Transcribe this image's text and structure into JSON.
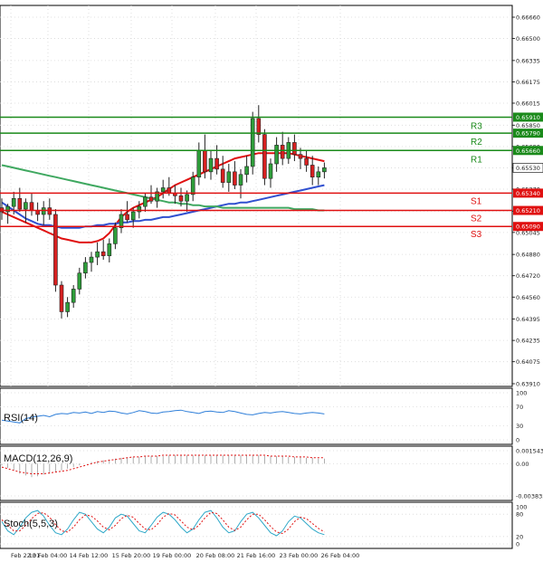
{
  "chart_data": {
    "type": "candlestick",
    "price_axis": {
      "ticks": [
        "0.66660",
        "0.66500",
        "0.66335",
        "0.66175",
        "0.66015",
        "0.65850",
        "0.65690",
        "0.65530",
        "0.65370",
        "0.65205",
        "0.65045",
        "0.64880",
        "0.64720",
        "0.64560",
        "0.64395",
        "0.64235",
        "0.64075",
        "0.63910"
      ],
      "ylim": [
        0.6391,
        0.6666
      ]
    },
    "levels": [
      {
        "label": "R3",
        "value": "0.65910",
        "color": "#1a8a1a"
      },
      {
        "label": "R2",
        "value": "0.65790",
        "color": "#1a8a1a"
      },
      {
        "label": "R1",
        "value": "0.65660",
        "color": "#1a8a1a"
      },
      {
        "label": "S1",
        "value": "0.65340",
        "color": "#e01010"
      },
      {
        "label": "S2",
        "value": "0.65210",
        "color": "#e01010"
      },
      {
        "label": "S3",
        "value": "0.65090",
        "color": "#e01010"
      }
    ],
    "current_price": "0.65530",
    "x_ticks": [
      "Feb 22:01",
      "13 Feb 04:00",
      "14 Feb 12:00",
      "15 Feb 20:00",
      "19 Feb 00:00",
      "20 Feb 08:00",
      "21 Feb 16:00",
      "23 Feb 00:00",
      "26 Feb 04:00"
    ],
    "candles": [
      {
        "o": 0.6523,
        "h": 0.653,
        "l": 0.6514,
        "c": 0.652
      },
      {
        "o": 0.652,
        "h": 0.6526,
        "l": 0.6511,
        "c": 0.6524
      },
      {
        "o": 0.6524,
        "h": 0.6535,
        "l": 0.6518,
        "c": 0.653
      },
      {
        "o": 0.653,
        "h": 0.6538,
        "l": 0.652,
        "c": 0.6522
      },
      {
        "o": 0.6522,
        "h": 0.653,
        "l": 0.6512,
        "c": 0.6527
      },
      {
        "o": 0.6527,
        "h": 0.6534,
        "l": 0.6517,
        "c": 0.6521
      },
      {
        "o": 0.6521,
        "h": 0.6527,
        "l": 0.6513,
        "c": 0.6518
      },
      {
        "o": 0.6518,
        "h": 0.6528,
        "l": 0.651,
        "c": 0.6523
      },
      {
        "o": 0.6523,
        "h": 0.653,
        "l": 0.6514,
        "c": 0.6518
      },
      {
        "o": 0.6518,
        "h": 0.6522,
        "l": 0.646,
        "c": 0.6465
      },
      {
        "o": 0.6465,
        "h": 0.6468,
        "l": 0.644,
        "c": 0.6445
      },
      {
        "o": 0.6445,
        "h": 0.6456,
        "l": 0.6441,
        "c": 0.6452
      },
      {
        "o": 0.6452,
        "h": 0.6465,
        "l": 0.6448,
        "c": 0.6462
      },
      {
        "o": 0.6462,
        "h": 0.6478,
        "l": 0.6458,
        "c": 0.6474
      },
      {
        "o": 0.6474,
        "h": 0.6486,
        "l": 0.647,
        "c": 0.6482
      },
      {
        "o": 0.6482,
        "h": 0.649,
        "l": 0.6475,
        "c": 0.6486
      },
      {
        "o": 0.6486,
        "h": 0.6497,
        "l": 0.648,
        "c": 0.649
      },
      {
        "o": 0.649,
        "h": 0.6499,
        "l": 0.6484,
        "c": 0.6487
      },
      {
        "o": 0.6487,
        "h": 0.65,
        "l": 0.6482,
        "c": 0.6496
      },
      {
        "o": 0.6496,
        "h": 0.6512,
        "l": 0.6492,
        "c": 0.6508
      },
      {
        "o": 0.6508,
        "h": 0.6522,
        "l": 0.6504,
        "c": 0.6518
      },
      {
        "o": 0.6518,
        "h": 0.6528,
        "l": 0.6512,
        "c": 0.6514
      },
      {
        "o": 0.6514,
        "h": 0.6523,
        "l": 0.6508,
        "c": 0.652
      },
      {
        "o": 0.652,
        "h": 0.6528,
        "l": 0.6515,
        "c": 0.6524
      },
      {
        "o": 0.6524,
        "h": 0.6534,
        "l": 0.652,
        "c": 0.6531
      },
      {
        "o": 0.6531,
        "h": 0.654,
        "l": 0.6526,
        "c": 0.6528
      },
      {
        "o": 0.6528,
        "h": 0.6538,
        "l": 0.6523,
        "c": 0.6535
      },
      {
        "o": 0.6535,
        "h": 0.6544,
        "l": 0.653,
        "c": 0.6538
      },
      {
        "o": 0.6538,
        "h": 0.6546,
        "l": 0.6532,
        "c": 0.6534
      },
      {
        "o": 0.6534,
        "h": 0.654,
        "l": 0.6526,
        "c": 0.6532
      },
      {
        "o": 0.6532,
        "h": 0.6538,
        "l": 0.6524,
        "c": 0.6528
      },
      {
        "o": 0.6528,
        "h": 0.6536,
        "l": 0.652,
        "c": 0.6533
      },
      {
        "o": 0.6533,
        "h": 0.655,
        "l": 0.6528,
        "c": 0.6546
      },
      {
        "o": 0.6546,
        "h": 0.6572,
        "l": 0.654,
        "c": 0.6566
      },
      {
        "o": 0.6566,
        "h": 0.6578,
        "l": 0.6545,
        "c": 0.655
      },
      {
        "o": 0.655,
        "h": 0.6566,
        "l": 0.6544,
        "c": 0.656
      },
      {
        "o": 0.656,
        "h": 0.657,
        "l": 0.6548,
        "c": 0.6552
      },
      {
        "o": 0.6552,
        "h": 0.6562,
        "l": 0.6538,
        "c": 0.6542
      },
      {
        "o": 0.6542,
        "h": 0.6556,
        "l": 0.6535,
        "c": 0.655
      },
      {
        "o": 0.655,
        "h": 0.6558,
        "l": 0.6537,
        "c": 0.654
      },
      {
        "o": 0.654,
        "h": 0.6552,
        "l": 0.653,
        "c": 0.6548
      },
      {
        "o": 0.6548,
        "h": 0.6562,
        "l": 0.6542,
        "c": 0.6554
      },
      {
        "o": 0.6554,
        "h": 0.6595,
        "l": 0.6548,
        "c": 0.659
      },
      {
        "o": 0.659,
        "h": 0.66,
        "l": 0.6572,
        "c": 0.6578
      },
      {
        "o": 0.6578,
        "h": 0.6582,
        "l": 0.654,
        "c": 0.6545
      },
      {
        "o": 0.6545,
        "h": 0.656,
        "l": 0.6538,
        "c": 0.6556
      },
      {
        "o": 0.6556,
        "h": 0.6576,
        "l": 0.655,
        "c": 0.657
      },
      {
        "o": 0.657,
        "h": 0.658,
        "l": 0.6555,
        "c": 0.656
      },
      {
        "o": 0.656,
        "h": 0.6576,
        "l": 0.6556,
        "c": 0.6572
      },
      {
        "o": 0.6572,
        "h": 0.6578,
        "l": 0.6558,
        "c": 0.6563
      },
      {
        "o": 0.6563,
        "h": 0.6568,
        "l": 0.6552,
        "c": 0.656
      },
      {
        "o": 0.656,
        "h": 0.6566,
        "l": 0.655,
        "c": 0.6555
      },
      {
        "o": 0.6555,
        "h": 0.6562,
        "l": 0.654,
        "c": 0.6546
      },
      {
        "o": 0.6546,
        "h": 0.6554,
        "l": 0.654,
        "c": 0.655
      },
      {
        "o": 0.655,
        "h": 0.6557,
        "l": 0.6545,
        "c": 0.6553
      }
    ],
    "moving_averages": [
      {
        "color": "#e01010",
        "values": [
          0.652,
          0.6518,
          0.6516,
          0.6514,
          0.6512,
          0.651,
          0.6508,
          0.6506,
          0.6504,
          0.6502,
          0.65,
          0.6499,
          0.6498,
          0.6497,
          0.6497,
          0.6497,
          0.6498,
          0.65,
          0.6504,
          0.651,
          0.6516,
          0.652,
          0.6523,
          0.6525,
          0.6527,
          0.6529,
          0.6531,
          0.6534,
          0.6537,
          0.654,
          0.6542,
          0.6544,
          0.6546,
          0.6548,
          0.655,
          0.6552,
          0.6554,
          0.6556,
          0.6558,
          0.656,
          0.6561,
          0.6562,
          0.6563,
          0.6564,
          0.6564,
          0.6564,
          0.6564,
          0.6564,
          0.6564,
          0.6563,
          0.6562,
          0.6561,
          0.656,
          0.6559,
          0.6558
        ]
      },
      {
        "color": "#3050d0",
        "values": [
          0.6527,
          0.6524,
          0.6521,
          0.6518,
          0.6515,
          0.6513,
          0.6511,
          0.651,
          0.651,
          0.6509,
          0.6508,
          0.6508,
          0.6508,
          0.6508,
          0.6509,
          0.6509,
          0.651,
          0.651,
          0.6511,
          0.6511,
          0.6512,
          0.6512,
          0.6513,
          0.6513,
          0.6514,
          0.6514,
          0.6515,
          0.6516,
          0.6516,
          0.6517,
          0.6518,
          0.6519,
          0.652,
          0.6521,
          0.6522,
          0.6523,
          0.6524,
          0.6525,
          0.6526,
          0.6526,
          0.6527,
          0.6527,
          0.6528,
          0.6529,
          0.653,
          0.6531,
          0.6532,
          0.6533,
          0.6534,
          0.6535,
          0.6536,
          0.6537,
          0.6538,
          0.6539,
          0.654
        ]
      },
      {
        "color": "#3fa860",
        "values": [
          0.6555,
          0.6554,
          0.6553,
          0.6552,
          0.6551,
          0.655,
          0.6549,
          0.6548,
          0.6547,
          0.6546,
          0.6545,
          0.6544,
          0.6543,
          0.6542,
          0.6541,
          0.654,
          0.6539,
          0.6538,
          0.6537,
          0.6536,
          0.6535,
          0.6534,
          0.6533,
          0.6532,
          0.6531,
          0.653,
          0.6529,
          0.6528,
          0.6527,
          0.6527,
          0.6526,
          0.6526,
          0.6525,
          0.6525,
          0.6524,
          0.6524,
          0.6524,
          0.6523,
          0.6523,
          0.6523,
          0.6523,
          0.6523,
          0.6523,
          0.6523,
          0.6523,
          0.6523,
          0.6523,
          0.6523,
          0.6523,
          0.6522,
          0.6522,
          0.6522,
          0.6522,
          0.6521,
          0.6521
        ]
      }
    ],
    "panels": [
      {
        "title": "RSI(14)",
        "ticks": [
          "100",
          "70",
          "30",
          "0"
        ],
        "ylim": [
          0,
          100
        ],
        "series": [
          {
            "color": "#2f7fd9",
            "style": "solid",
            "values": [
              42,
              40,
              38,
              36,
              45,
              48,
              50,
              52,
              49,
              54,
              56,
              55,
              58,
              57,
              59,
              56,
              60,
              58,
              61,
              60,
              57,
              55,
              58,
              62,
              60,
              57,
              56,
              59,
              60,
              62,
              63,
              60,
              58,
              56,
              60,
              61,
              59,
              58,
              62,
              60,
              57,
              54,
              53,
              56,
              58,
              57,
              59,
              60,
              58,
              56,
              55,
              57,
              58,
              57,
              55
            ]
          }
        ]
      },
      {
        "title": "MACD(12,26,9)",
        "ticks": [
          "0.001543",
          "0.00",
          "-0.003835"
        ],
        "ylim": [
          -0.003835,
          0.001543
        ],
        "series": [
          {
            "color": "#e01010",
            "style": "dashed",
            "values": [
              -0.0004,
              -0.0006,
              -0.0008,
              -0.001,
              -0.0011,
              -0.0012,
              -0.0012,
              -0.0012,
              -0.0011,
              -0.001,
              -0.0009,
              -0.0008,
              -0.0006,
              -0.0004,
              -0.0002,
              0.0,
              0.0002,
              0.0003,
              0.0004,
              0.0005,
              0.0006,
              0.0007,
              0.0008,
              0.0008,
              0.0009,
              0.0009,
              0.0009,
              0.001,
              0.001,
              0.001,
              0.001,
              0.001,
              0.001,
              0.001,
              0.001,
              0.001,
              0.001,
              0.001,
              0.001,
              0.001,
              0.001,
              0.001,
              0.001,
              0.001,
              0.001,
              0.0009,
              0.0009,
              0.0009,
              0.0009,
              0.0008,
              0.0008,
              0.0008,
              0.0007,
              0.0007,
              0.0007
            ]
          }
        ],
        "histogram": [
          -0.0002,
          -0.0005,
          -0.0008,
          -0.0012,
          -0.0014,
          -0.0016,
          -0.0015,
          -0.0013,
          -0.0012,
          -0.001,
          -0.0008,
          -0.0006,
          -0.0004,
          -0.0002,
          0.0,
          0.0002,
          0.0003,
          0.0004,
          0.0005,
          0.0006,
          0.0007,
          0.0007,
          0.0008,
          0.0008,
          0.0009,
          0.0009,
          0.0009,
          0.0009,
          0.001,
          0.001,
          0.001,
          0.001,
          0.001,
          0.001,
          0.001,
          0.001,
          0.001,
          0.001,
          0.001,
          0.001,
          0.001,
          0.001,
          0.001,
          0.001,
          0.0009,
          0.0009,
          0.0009,
          0.0009,
          0.0008,
          0.0008,
          0.0008,
          0.0007,
          0.0007,
          0.0006,
          0.0006
        ]
      },
      {
        "title": "Stoch(5,5,3)",
        "ticks": [
          "100",
          "80",
          "20",
          "0"
        ],
        "ylim": [
          0,
          100
        ],
        "series": [
          {
            "color": "#2fa8c8",
            "style": "solid",
            "values": [
              60,
              35,
              25,
              45,
              70,
              85,
              90,
              75,
              50,
              30,
              25,
              40,
              65,
              85,
              80,
              60,
              40,
              30,
              45,
              70,
              80,
              75,
              55,
              35,
              30,
              50,
              72,
              85,
              80,
              65,
              45,
              30,
              40,
              65,
              85,
              90,
              70,
              45,
              30,
              35,
              60,
              80,
              85,
              70,
              50,
              30,
              22,
              35,
              60,
              75,
              70,
              55,
              40,
              30,
              25
            ]
          },
          {
            "color": "#e01010",
            "style": "dashed",
            "values": [
              65,
              50,
              35,
              35,
              50,
              68,
              82,
              84,
              72,
              52,
              35,
              32,
              45,
              65,
              78,
              75,
              62,
              45,
              38,
              50,
              68,
              77,
              72,
              55,
              40,
              38,
              52,
              72,
              82,
              78,
              62,
              45,
              38,
              50,
              70,
              85,
              82,
              65,
              45,
              36,
              45,
              65,
              80,
              80,
              65,
              47,
              32,
              28,
              40,
              60,
              72,
              68,
              55,
              42,
              32
            ]
          }
        ]
      }
    ]
  }
}
